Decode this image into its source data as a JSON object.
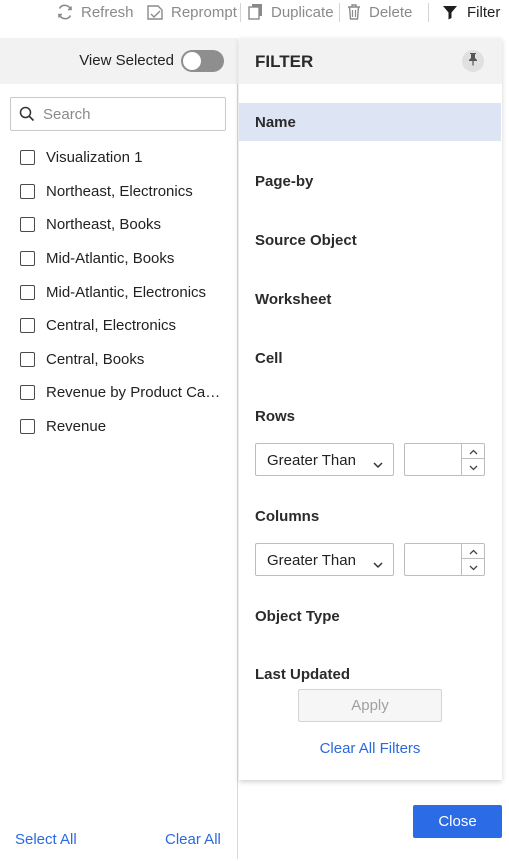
{
  "toolbar": {
    "refresh_label": "Refresh",
    "reprompt_label": "Reprompt",
    "duplicate_label": "Duplicate",
    "delete_label": "Delete",
    "filter_label": "Filter"
  },
  "left_panel": {
    "view_selected_label": "View Selected",
    "view_selected_on": false,
    "search_placeholder": "Search",
    "items": [
      {
        "label": "Visualization 1",
        "checked": false
      },
      {
        "label": "Northeast, Electronics",
        "checked": false
      },
      {
        "label": "Northeast, Books",
        "checked": false
      },
      {
        "label": "Mid-Atlantic, Books",
        "checked": false
      },
      {
        "label": "Mid-Atlantic, Electronics",
        "checked": false
      },
      {
        "label": "Central, Electronics",
        "checked": false
      },
      {
        "label": "Central, Books",
        "checked": false
      },
      {
        "label": "Revenue by Product Cat…",
        "checked": false
      },
      {
        "label": "Revenue",
        "checked": false
      }
    ],
    "select_all_label": "Select All",
    "clear_all_label": "Clear All"
  },
  "filter_panel": {
    "title": "FILTER",
    "sections": {
      "name": "Name",
      "page_by": "Page-by",
      "source_object": "Source Object",
      "worksheet": "Worksheet",
      "cell": "Cell",
      "rows": "Rows",
      "columns": "Columns",
      "object_type": "Object Type",
      "last_updated": "Last Updated"
    },
    "rows_operator": "Greater Than",
    "rows_value": "",
    "columns_operator": "Greater Than",
    "columns_value": "",
    "apply_label": "Apply",
    "clear_all_filters_label": "Clear All Filters"
  },
  "close_label": "Close",
  "colors": {
    "accent": "#2b6be6",
    "link": "#2a6ae0",
    "active_row": "#dde5f5",
    "header_bg": "#f2f2f2"
  },
  "icons": [
    "refresh-icon",
    "reprompt-icon",
    "duplicate-icon",
    "trash-icon",
    "filter-icon",
    "search-icon",
    "pin-icon",
    "chevron-down-icon",
    "chevron-up-icon"
  ]
}
